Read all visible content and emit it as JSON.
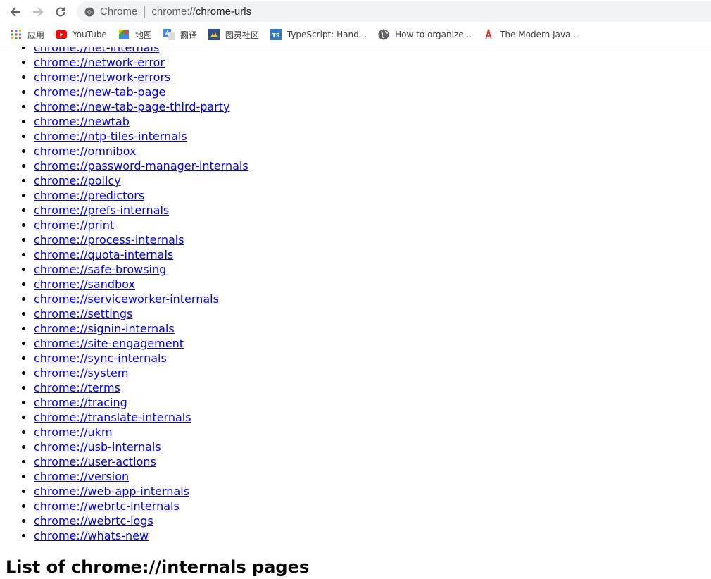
{
  "omnibox": {
    "site_chip": "Chrome",
    "url_scheme": "chrome://",
    "url_host": "chrome-urls"
  },
  "bookmarks": [
    {
      "label": "应用",
      "icon": "apps-grid-icon",
      "name": "bookmark-apps"
    },
    {
      "label": "YouTube",
      "icon": "youtube-icon",
      "name": "bookmark-youtube"
    },
    {
      "label": "地图",
      "icon": "maps-icon",
      "name": "bookmark-maps"
    },
    {
      "label": "翻译",
      "icon": "translate-icon",
      "name": "bookmark-translate"
    },
    {
      "label": "图灵社区",
      "icon": "turing-icon",
      "name": "bookmark-turing"
    },
    {
      "label": "TypeScript: Hand...",
      "icon": "typescript-icon",
      "name": "bookmark-typescript"
    },
    {
      "label": "How to organize...",
      "icon": "globe-icon",
      "name": "bookmark-how-to-organize"
    },
    {
      "label": "The Modern Java...",
      "icon": "tower-icon",
      "name": "bookmark-modern-java"
    }
  ],
  "urls": [
    "chrome://net-internals",
    "chrome://network-error",
    "chrome://network-errors",
    "chrome://new-tab-page",
    "chrome://new-tab-page-third-party",
    "chrome://newtab",
    "chrome://ntp-tiles-internals",
    "chrome://omnibox",
    "chrome://password-manager-internals",
    "chrome://policy",
    "chrome://predictors",
    "chrome://prefs-internals",
    "chrome://print",
    "chrome://process-internals",
    "chrome://quota-internals",
    "chrome://safe-browsing",
    "chrome://sandbox",
    "chrome://serviceworker-internals",
    "chrome://settings",
    "chrome://signin-internals",
    "chrome://site-engagement",
    "chrome://sync-internals",
    "chrome://system",
    "chrome://terms",
    "chrome://tracing",
    "chrome://translate-internals",
    "chrome://ukm",
    "chrome://usb-internals",
    "chrome://user-actions",
    "chrome://version",
    "chrome://web-app-internals",
    "chrome://webrtc-internals",
    "chrome://webrtc-logs",
    "chrome://whats-new"
  ],
  "section_heading": "List of chrome://internals pages"
}
